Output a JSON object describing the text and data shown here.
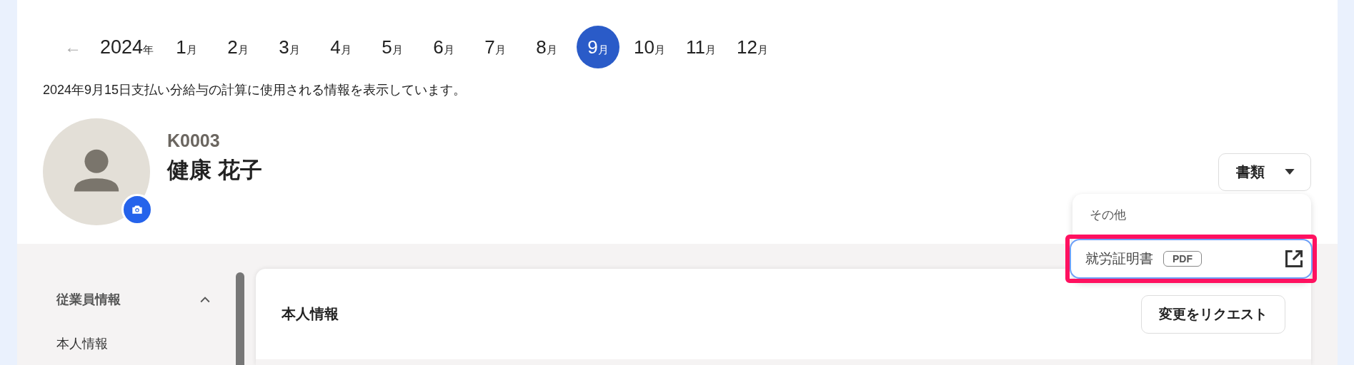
{
  "period": {
    "back_arrow": "←",
    "year": {
      "number": "2024",
      "unit": "年"
    },
    "months": [
      {
        "number": "1",
        "unit": "月",
        "selected": false
      },
      {
        "number": "2",
        "unit": "月",
        "selected": false
      },
      {
        "number": "3",
        "unit": "月",
        "selected": false
      },
      {
        "number": "4",
        "unit": "月",
        "selected": false
      },
      {
        "number": "5",
        "unit": "月",
        "selected": false
      },
      {
        "number": "6",
        "unit": "月",
        "selected": false
      },
      {
        "number": "7",
        "unit": "月",
        "selected": false
      },
      {
        "number": "8",
        "unit": "月",
        "selected": false
      },
      {
        "number": "9",
        "unit": "月",
        "selected": true
      },
      {
        "number": "10",
        "unit": "月",
        "selected": false
      },
      {
        "number": "11",
        "unit": "月",
        "selected": false
      },
      {
        "number": "12",
        "unit": "月",
        "selected": false
      }
    ]
  },
  "notice": "2024年9月15日支払い分給与の計算に使用される情報を表示しています。",
  "employee": {
    "code": "K0003",
    "name": "健康 花子"
  },
  "documents": {
    "label": "書類",
    "expanded": true,
    "menu": [
      {
        "kind": "header",
        "label": "その他"
      },
      {
        "kind": "link",
        "label": "就労証明書",
        "tag": "PDF",
        "highlighted": true
      }
    ]
  },
  "sidebar": {
    "section": "従業員情報",
    "expanded": true,
    "items": [
      {
        "label": "本人情報"
      }
    ]
  },
  "card": {
    "title": "本人情報",
    "button": "変更をリクエスト"
  }
}
